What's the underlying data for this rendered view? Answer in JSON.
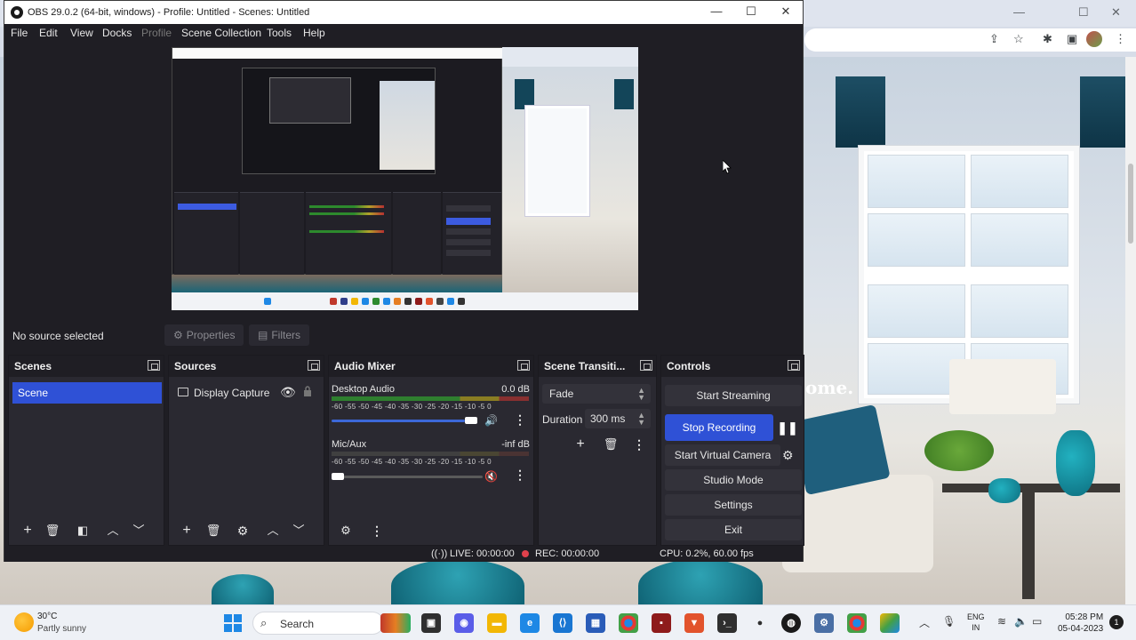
{
  "obs": {
    "window_title": "OBS 29.0.2 (64-bit, windows) - Profile: Untitled - Scenes: Untitled",
    "window_controls": {
      "minimize": "—",
      "maximize": "☐",
      "close": "✕"
    },
    "menu": [
      "File",
      "Edit",
      "View",
      "Docks",
      "Profile",
      "Scene Collection",
      "Tools",
      "Help"
    ],
    "source_toolbar": {
      "no_source_text": "No source selected",
      "properties_label": "Properties",
      "filters_label": "Filters"
    },
    "scenes_dock": {
      "title": "Scenes",
      "items": [
        "Scene"
      ],
      "selected": "Scene"
    },
    "sources_dock": {
      "title": "Sources",
      "items": [
        {
          "label": "Display Capture",
          "visible": true,
          "locked": false
        }
      ]
    },
    "audio_mixer": {
      "title": "Audio Mixer",
      "meter_scale": "-60 -55 -50 -45 -40 -35 -30 -25 -20 -15 -10 -5 0",
      "channels": [
        {
          "name": "Desktop Audio",
          "db": "0.0 dB",
          "muted": false,
          "volume_fraction": 1.0
        },
        {
          "name": "Mic/Aux",
          "db": "-inf dB",
          "muted": true,
          "volume_fraction": 0.0
        }
      ]
    },
    "scene_transitions": {
      "title": "Scene Transiti...",
      "transition": "Fade",
      "duration_label": "Duration",
      "duration_value": "300 ms"
    },
    "controls": {
      "title": "Controls",
      "start_streaming": "Start Streaming",
      "stop_recording": "Stop Recording",
      "start_virtual_camera": "Start Virtual Camera",
      "studio_mode": "Studio Mode",
      "settings": "Settings",
      "exit": "Exit"
    },
    "status": {
      "live": "LIVE: 00:00:00",
      "rec": "REC: 00:00:00",
      "cpu": "CPU: 0.2%, 60.00 fps"
    }
  },
  "browser": {
    "page_overlay_text": "ome."
  },
  "taskbar": {
    "temperature": "30°C",
    "weather": "Partly sunny",
    "search_placeholder": "Search",
    "language": "ENG",
    "region": "IN",
    "time": "05:28 PM",
    "date": "05-04-2023",
    "notification_count": "1"
  },
  "colors": {
    "obs_accent": "#2f51d6",
    "obs_bg": "#1f1e24",
    "dock_bg": "#2a2931",
    "rec_red": "#e0414c"
  }
}
